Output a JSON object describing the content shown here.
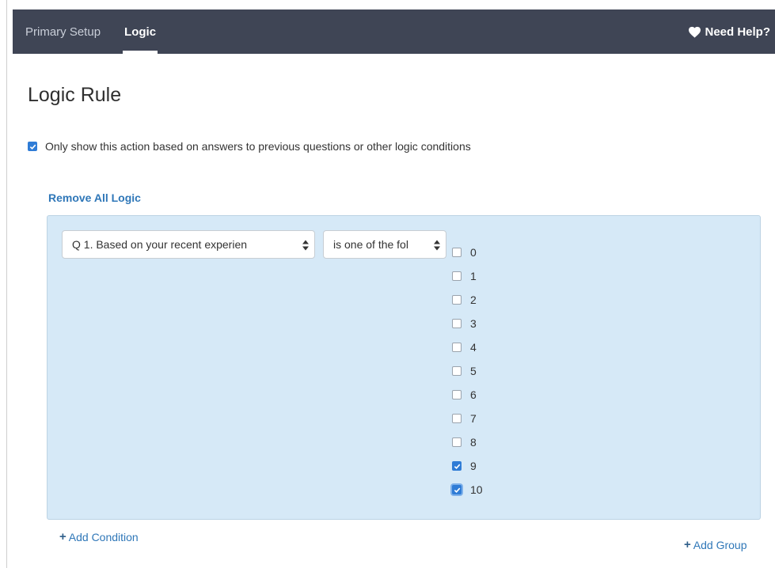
{
  "nav": {
    "tabs": [
      {
        "label": "Primary Setup",
        "active": false
      },
      {
        "label": "Logic",
        "active": true
      }
    ],
    "help_label": "Need Help?",
    "bar_color": "#3f4555"
  },
  "page": {
    "title": "Logic Rule",
    "only_show_label": "Only show this action based on answers to previous questions or other logic conditions",
    "only_show_checked": true,
    "remove_all_label": "Remove All Logic"
  },
  "condition": {
    "question_select": "Q 1. Based on your recent experien",
    "operator_select": "is one of the fol",
    "options": [
      {
        "label": "0",
        "checked": false
      },
      {
        "label": "1",
        "checked": false
      },
      {
        "label": "2",
        "checked": false
      },
      {
        "label": "3",
        "checked": false
      },
      {
        "label": "4",
        "checked": false
      },
      {
        "label": "5",
        "checked": false
      },
      {
        "label": "6",
        "checked": false
      },
      {
        "label": "7",
        "checked": false
      },
      {
        "label": "8",
        "checked": false
      },
      {
        "label": "9",
        "checked": true
      },
      {
        "label": "10",
        "checked": true
      }
    ]
  },
  "actions": {
    "add_condition": "Add Condition",
    "add_group": "Add Group"
  },
  "colors": {
    "accent": "#2f77b8",
    "logic_box_bg": "#d6e9f7",
    "checkbox_checked": "#2f7cd6"
  }
}
